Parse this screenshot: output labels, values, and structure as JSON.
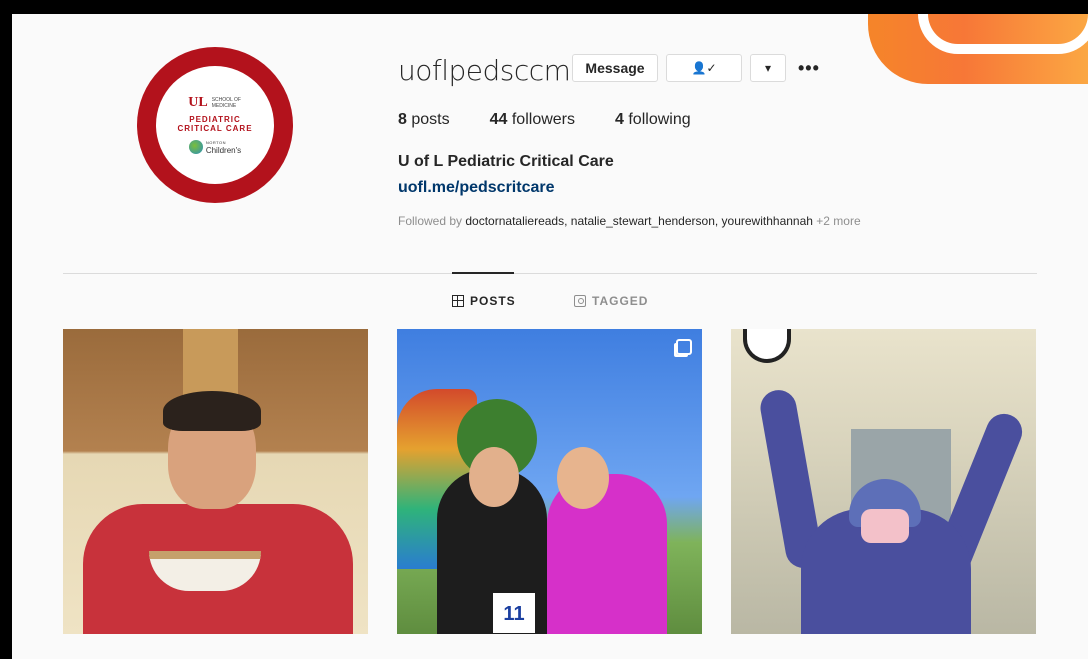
{
  "profile": {
    "username": "uoflpedsccm",
    "full_name": "U of L Pediatric Critical Care",
    "link": "uofl.me/pedscritcare",
    "avatar": {
      "logo": "UL",
      "school": "SCHOOL OF MEDICINE",
      "line1": "PEDIATRIC",
      "line2": "CRITICAL CARE",
      "partner_small": "NORTON",
      "partner": "Children's"
    }
  },
  "actions": {
    "message_label": "Message",
    "following_icon": "person-check-icon",
    "dropdown_icon": "chevron-down-icon",
    "more_icon": "more-horizontal-icon",
    "following_glyph": "👤✓",
    "dropdown_glyph": "▾",
    "more_glyph": "•••"
  },
  "stats": {
    "posts_count": "8",
    "posts_label": "posts",
    "followers_count": "44",
    "followers_label": "followers",
    "following_count": "4",
    "following_label": "following"
  },
  "followed_by": {
    "prefix": "Followed by ",
    "names": "doctornataliereads, natalie_stewart_henderson, yourewithhannah",
    "suffix": " +2 more"
  },
  "tabs": [
    {
      "label": "POSTS",
      "icon": "grid-icon",
      "active": true
    },
    {
      "label": "TAGGED",
      "icon": "tag-icon",
      "active": false
    }
  ],
  "posts": [
    {
      "kind": "photo",
      "multiple": false
    },
    {
      "kind": "photo",
      "multiple": true,
      "bib_number": "11"
    },
    {
      "kind": "photo",
      "multiple": false
    }
  ],
  "colors": {
    "avatar_ring": "#b3121c",
    "link": "#00376b",
    "muted": "#8e8e8e",
    "text": "#262626"
  }
}
